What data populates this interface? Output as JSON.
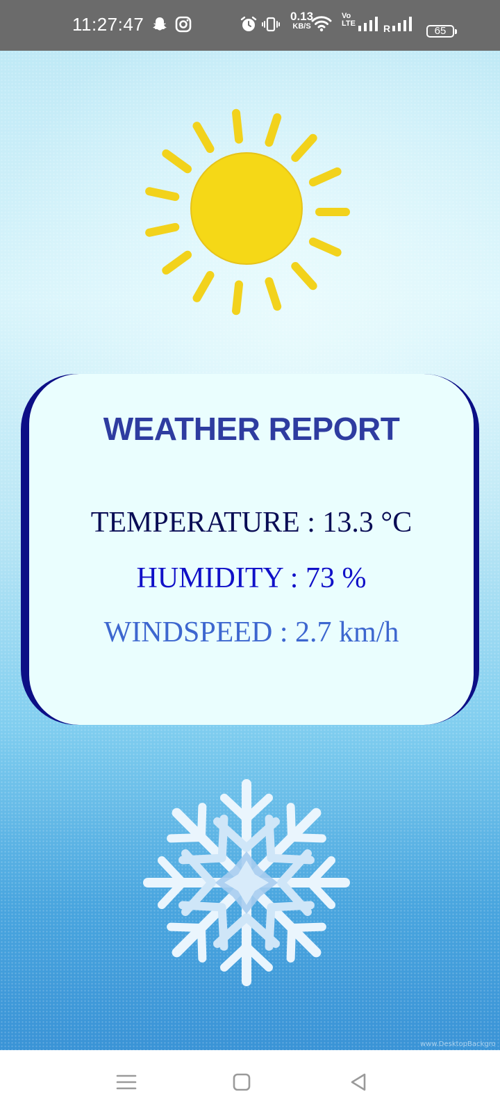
{
  "status_bar": {
    "time": "11:27:47",
    "net_speed_value": "0.13",
    "net_speed_unit": "KB/S",
    "volte_top": "Vo",
    "volte_bottom": "LTE",
    "roaming_label": "R",
    "battery_level": "65",
    "icons": [
      "snapchat-icon",
      "instagram-icon",
      "alarm-icon",
      "vibrate-icon",
      "wifi-icon",
      "signal-icon",
      "signal-roaming-icon",
      "battery-icon"
    ]
  },
  "weather": {
    "title": "WEATHER REPORT",
    "temperature_text": "TEMPERATURE : 13.3 °C",
    "humidity_text": "HUMIDITY : 73 %",
    "windspeed_text": "WINDSPEED : 2.7 km/h"
  },
  "decor": {
    "top_icon": "sun-icon",
    "bottom_icon": "snowflake-icon",
    "watermark": "www.DesktopBackgro"
  },
  "nav_bar": {
    "buttons": [
      "menu-icon",
      "home-icon",
      "back-icon"
    ]
  },
  "colors": {
    "status_bar": "#6b6b6b",
    "sun": "#f5d817",
    "card_bg": "#eafefe",
    "card_border": "#0c0f86",
    "title": "#2e3ca0",
    "temperature": "#0a0d55",
    "humidity": "#1010c8",
    "windspeed": "#3d67cf"
  }
}
